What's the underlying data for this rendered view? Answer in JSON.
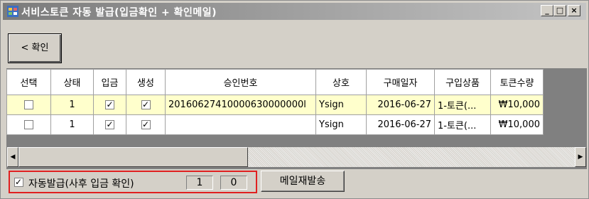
{
  "window": {
    "title": "서비스토큰 자동 발급(입금확인 + 확인메일)",
    "controls": {
      "minimize": "_",
      "maximize": "□",
      "close": "×"
    }
  },
  "toolbar": {
    "back_label": "< 확인"
  },
  "grid": {
    "columns": [
      "선택",
      "상태",
      "입금",
      "생성",
      "승인번호",
      "상호",
      "구매일자",
      "구입상품",
      "토큰수량"
    ],
    "rows": [
      {
        "select": false,
        "status": "1",
        "deposit": true,
        "created": true,
        "approval_no": "20160627410000630000000l",
        "company": "Ysign",
        "purchase_date": "2016-06-27",
        "product": "1-토큰(...",
        "token_qty": "₩10,000"
      },
      {
        "select": false,
        "status": "1",
        "deposit": true,
        "created": true,
        "approval_no": "",
        "company": "Ysign",
        "purchase_date": "2016-06-27",
        "product": "1-토큰(...",
        "token_qty": "₩10,000"
      }
    ]
  },
  "scrollbar": {
    "left_arrow": "◀",
    "right_arrow": "▶"
  },
  "auto_issue": {
    "checked": true,
    "label": "자동발급(사후 입금 확인)",
    "count_a": "1",
    "count_b": "0"
  },
  "resend_button": "메일재발송"
}
